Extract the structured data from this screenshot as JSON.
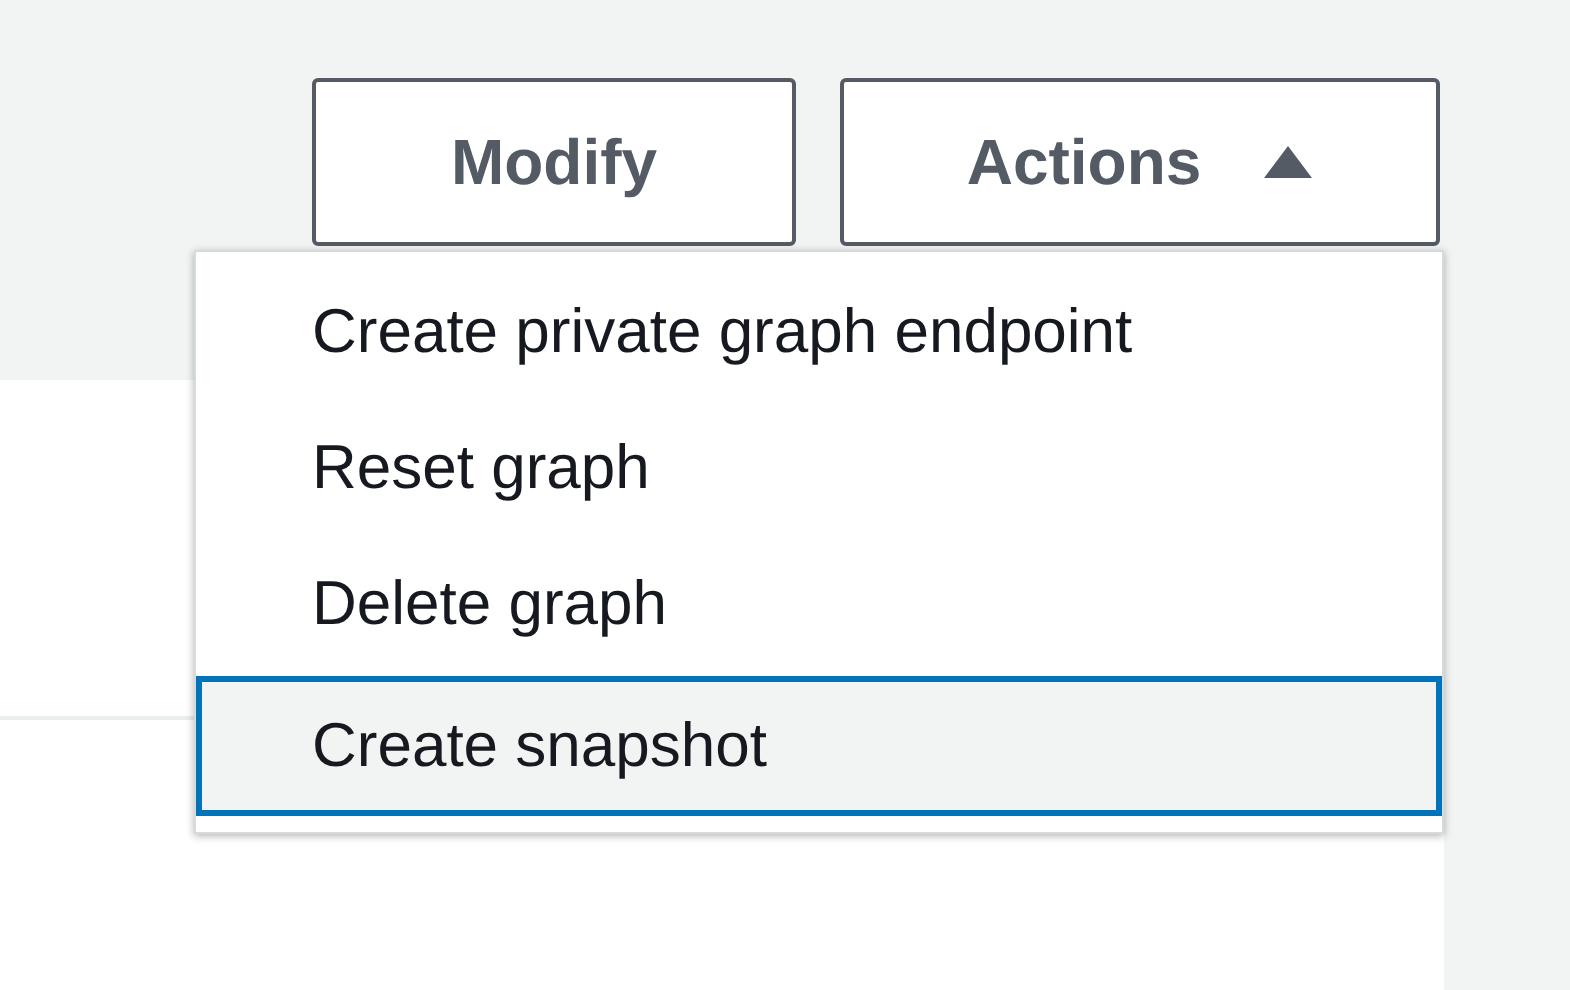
{
  "buttons": [
    {
      "label": "Modify",
      "kind": "plain"
    },
    {
      "label": "Actions",
      "kind": "dropdown",
      "expanded": true
    }
  ],
  "menu": {
    "items": [
      {
        "label": "Create private graph endpoint",
        "selected": false
      },
      {
        "label": "Reset graph",
        "selected": false
      },
      {
        "label": "Delete graph",
        "selected": false
      },
      {
        "label": "Create snapshot",
        "selected": true
      }
    ]
  }
}
